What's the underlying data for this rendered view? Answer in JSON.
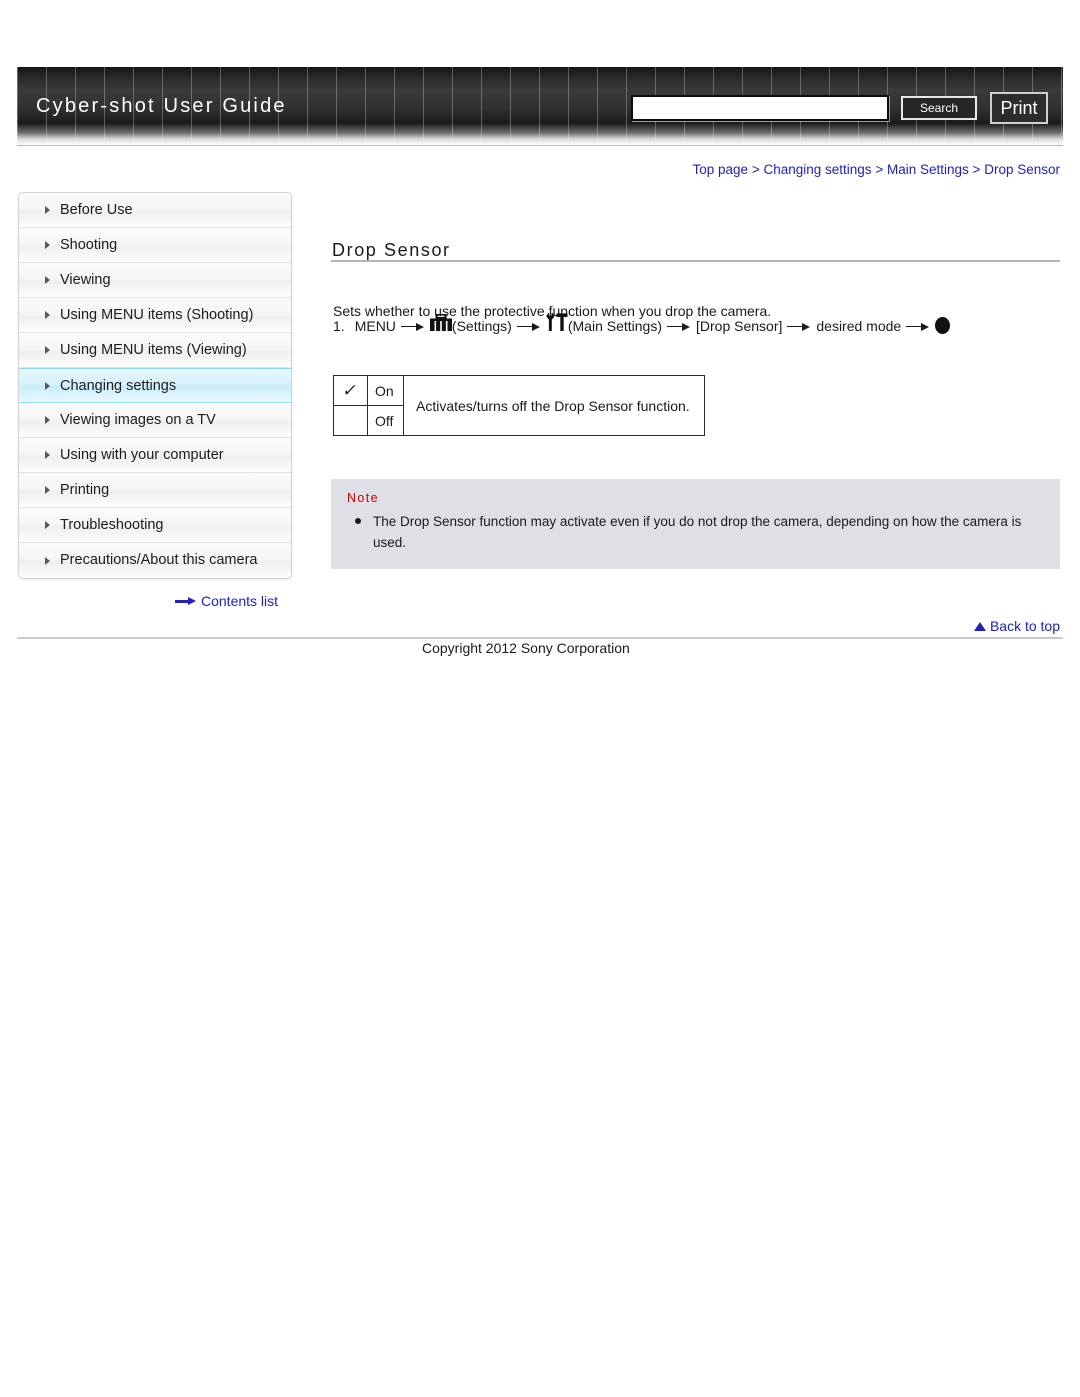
{
  "header": {
    "title": "Cyber-shot User Guide",
    "search_placeholder": "",
    "search_value": "",
    "search_button": "Search",
    "print_button": "Print"
  },
  "breadcrumb": {
    "separator": ">",
    "items": [
      "Top page",
      "Changing settings",
      "Main Settings",
      "Drop Sensor"
    ]
  },
  "sidebar": {
    "items": [
      {
        "label": "Before Use",
        "active": false
      },
      {
        "label": "Shooting",
        "active": false
      },
      {
        "label": "Viewing",
        "active": false
      },
      {
        "label": "Using MENU items (Shooting)",
        "active": false
      },
      {
        "label": "Using MENU items (Viewing)",
        "active": false
      },
      {
        "label": "Changing settings",
        "active": true
      },
      {
        "label": "Viewing images on a TV",
        "active": false
      },
      {
        "label": "Using with your computer",
        "active": false
      },
      {
        "label": "Printing",
        "active": false
      },
      {
        "label": "Troubleshooting",
        "active": false
      },
      {
        "label": "Precautions/About this camera",
        "active": false
      }
    ],
    "contents_list_link": "Contents list"
  },
  "main": {
    "page_title": "Drop Sensor",
    "intro": "Sets whether to use the protective function when you drop the camera.",
    "step": {
      "number": "1.",
      "menu_label": "MENU",
      "settings_label": "(Settings)",
      "main_settings_label": "(Main Settings)",
      "item_label": "[Drop Sensor]",
      "desired_mode_label": "desired mode"
    },
    "options_table": {
      "rows": [
        {
          "checked": true,
          "mode": "On"
        },
        {
          "checked": false,
          "mode": "Off"
        }
      ],
      "description": "Activates/turns off the Drop Sensor function."
    },
    "note": {
      "title": "Note",
      "items": [
        "The Drop Sensor function may activate even if you do not drop the camera, depending on how the camera is used."
      ]
    }
  },
  "footer": {
    "back_to_top": "Back to top",
    "copyright": "Copyright 2012 Sony Corporation"
  }
}
